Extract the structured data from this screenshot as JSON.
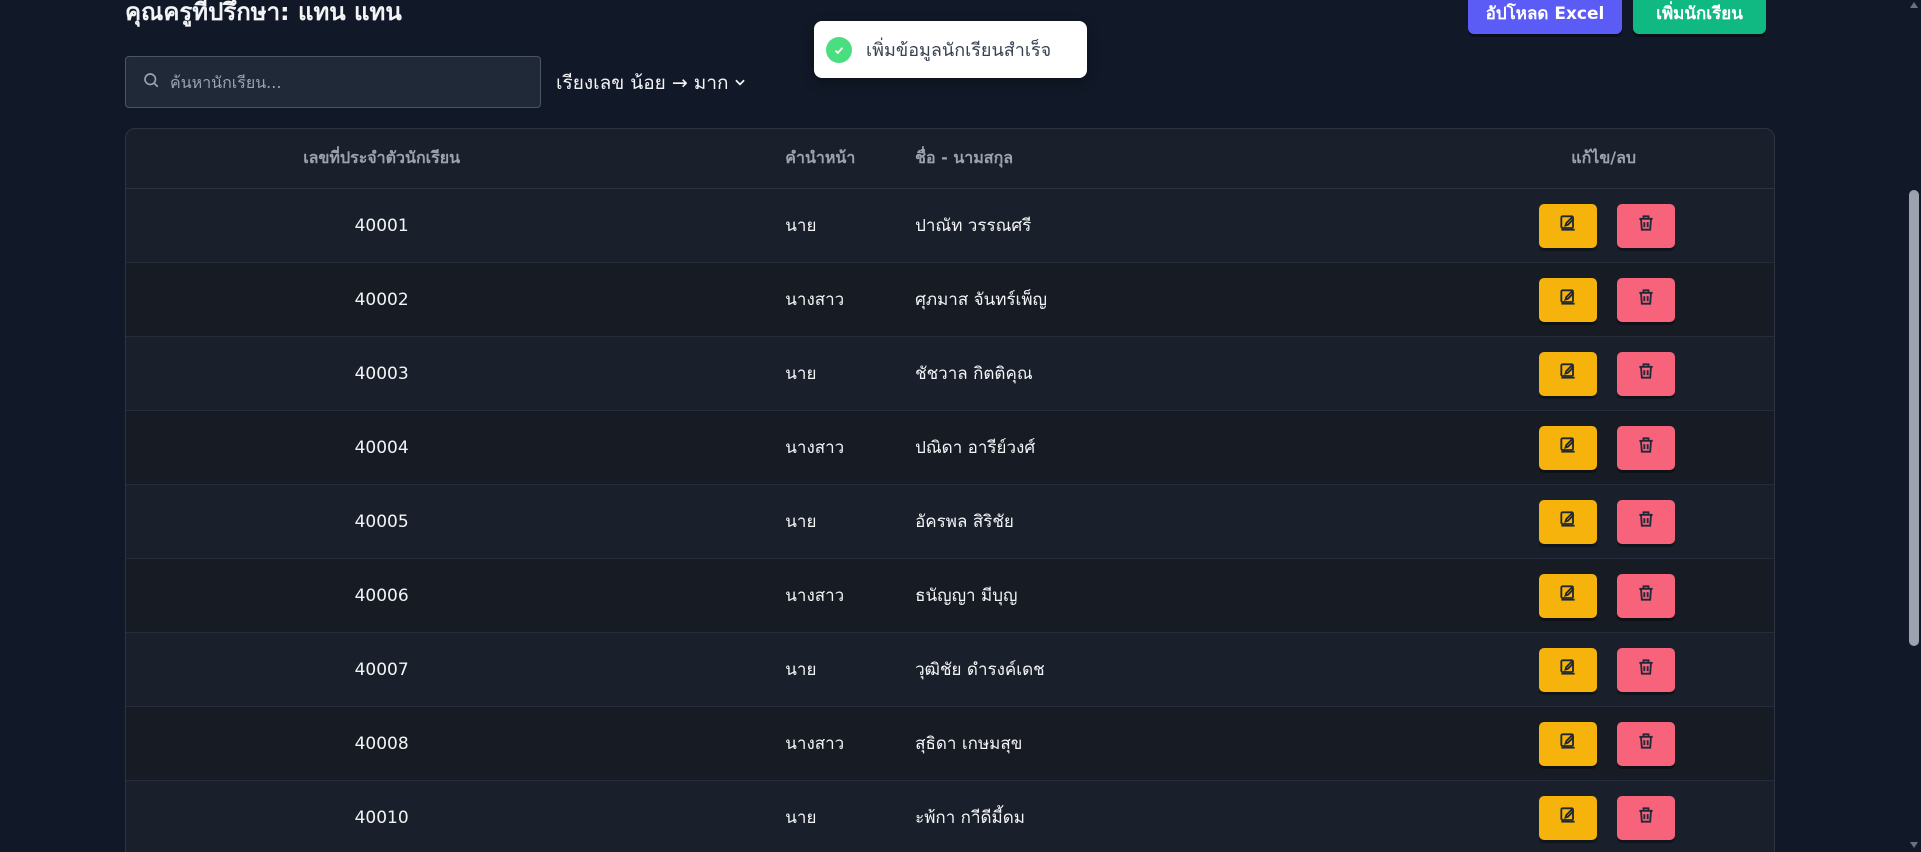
{
  "header": {
    "title": "คุณครูที่ปรึกษา: แทน แทน",
    "upload_label": "อัปโหลด Excel",
    "add_label": "เพิ่มนักเรียน"
  },
  "search": {
    "placeholder": "ค้นหานักเรียน..."
  },
  "sort": {
    "label": "เรียงเลข น้อย → มาก"
  },
  "toast": {
    "message": "เพิ่มข้อมูลนักเรียนสำเร็จ"
  },
  "table": {
    "columns": [
      "เลขที่ประจำตัวนักเรียน",
      "คำนำหน้า",
      "ชื่อ - นามสกุล",
      "แก้ไข/ลบ"
    ],
    "rows": [
      {
        "id": "40001",
        "prefix": "นาย",
        "name": "ปาณัท วรรณศรี"
      },
      {
        "id": "40002",
        "prefix": "นางสาว",
        "name": "ศุภมาส จันทร์เพ็ญ"
      },
      {
        "id": "40003",
        "prefix": "นาย",
        "name": "ชัชวาล กิตติคุณ"
      },
      {
        "id": "40004",
        "prefix": "นางสาว",
        "name": "ปณิดา อารีย์วงศ์"
      },
      {
        "id": "40005",
        "prefix": "นาย",
        "name": "อัครพล สิริชัย"
      },
      {
        "id": "40006",
        "prefix": "นางสาว",
        "name": "ธนัญญา มีบุญ"
      },
      {
        "id": "40007",
        "prefix": "นาย",
        "name": "วุฒิชัย ดำรงค์เดช"
      },
      {
        "id": "40008",
        "prefix": "นางสาว",
        "name": "สุธิดา เกษมสุข"
      },
      {
        "id": "40010",
        "prefix": "นาย",
        "name": "ะพ้กา กาีดีมี้ดม"
      }
    ]
  },
  "colors": {
    "background": "#111827",
    "upload_button": "#5b5bf6",
    "add_button": "#10b981",
    "edit_button": "#f5b30b",
    "delete_button": "#f7637b",
    "toast_icon": "#4ade80"
  },
  "icons": {
    "search": "search-icon",
    "sort": "chevron-down-icon",
    "toast": "check-circle-icon",
    "edit": "edit-icon",
    "delete": "trash-icon"
  }
}
